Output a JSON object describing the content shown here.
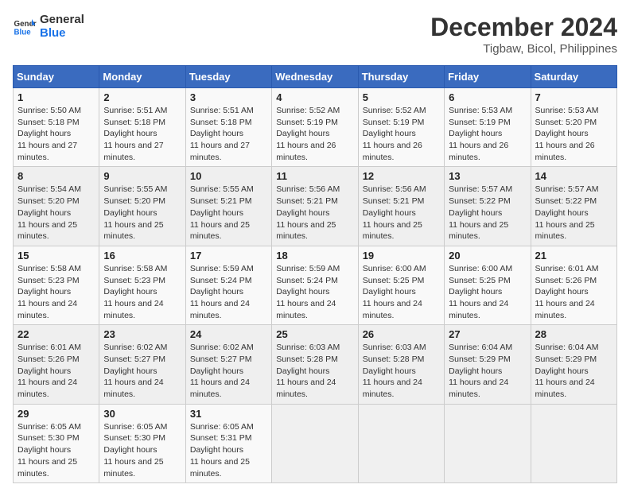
{
  "header": {
    "logo_line1": "General",
    "logo_line2": "Blue",
    "main_title": "December 2024",
    "subtitle": "Tigbaw, Bicol, Philippines"
  },
  "calendar": {
    "weekdays": [
      "Sunday",
      "Monday",
      "Tuesday",
      "Wednesday",
      "Thursday",
      "Friday",
      "Saturday"
    ],
    "weeks": [
      [
        {
          "day": "1",
          "sunrise": "5:50 AM",
          "sunset": "5:18 PM",
          "daylight": "11 hours and 27 minutes."
        },
        {
          "day": "2",
          "sunrise": "5:51 AM",
          "sunset": "5:18 PM",
          "daylight": "11 hours and 27 minutes."
        },
        {
          "day": "3",
          "sunrise": "5:51 AM",
          "sunset": "5:18 PM",
          "daylight": "11 hours and 27 minutes."
        },
        {
          "day": "4",
          "sunrise": "5:52 AM",
          "sunset": "5:19 PM",
          "daylight": "11 hours and 26 minutes."
        },
        {
          "day": "5",
          "sunrise": "5:52 AM",
          "sunset": "5:19 PM",
          "daylight": "11 hours and 26 minutes."
        },
        {
          "day": "6",
          "sunrise": "5:53 AM",
          "sunset": "5:19 PM",
          "daylight": "11 hours and 26 minutes."
        },
        {
          "day": "7",
          "sunrise": "5:53 AM",
          "sunset": "5:20 PM",
          "daylight": "11 hours and 26 minutes."
        }
      ],
      [
        {
          "day": "8",
          "sunrise": "5:54 AM",
          "sunset": "5:20 PM",
          "daylight": "11 hours and 25 minutes."
        },
        {
          "day": "9",
          "sunrise": "5:55 AM",
          "sunset": "5:20 PM",
          "daylight": "11 hours and 25 minutes."
        },
        {
          "day": "10",
          "sunrise": "5:55 AM",
          "sunset": "5:21 PM",
          "daylight": "11 hours and 25 minutes."
        },
        {
          "day": "11",
          "sunrise": "5:56 AM",
          "sunset": "5:21 PM",
          "daylight": "11 hours and 25 minutes."
        },
        {
          "day": "12",
          "sunrise": "5:56 AM",
          "sunset": "5:21 PM",
          "daylight": "11 hours and 25 minutes."
        },
        {
          "day": "13",
          "sunrise": "5:57 AM",
          "sunset": "5:22 PM",
          "daylight": "11 hours and 25 minutes."
        },
        {
          "day": "14",
          "sunrise": "5:57 AM",
          "sunset": "5:22 PM",
          "daylight": "11 hours and 25 minutes."
        }
      ],
      [
        {
          "day": "15",
          "sunrise": "5:58 AM",
          "sunset": "5:23 PM",
          "daylight": "11 hours and 24 minutes."
        },
        {
          "day": "16",
          "sunrise": "5:58 AM",
          "sunset": "5:23 PM",
          "daylight": "11 hours and 24 minutes."
        },
        {
          "day": "17",
          "sunrise": "5:59 AM",
          "sunset": "5:24 PM",
          "daylight": "11 hours and 24 minutes."
        },
        {
          "day": "18",
          "sunrise": "5:59 AM",
          "sunset": "5:24 PM",
          "daylight": "11 hours and 24 minutes."
        },
        {
          "day": "19",
          "sunrise": "6:00 AM",
          "sunset": "5:25 PM",
          "daylight": "11 hours and 24 minutes."
        },
        {
          "day": "20",
          "sunrise": "6:00 AM",
          "sunset": "5:25 PM",
          "daylight": "11 hours and 24 minutes."
        },
        {
          "day": "21",
          "sunrise": "6:01 AM",
          "sunset": "5:26 PM",
          "daylight": "11 hours and 24 minutes."
        }
      ],
      [
        {
          "day": "22",
          "sunrise": "6:01 AM",
          "sunset": "5:26 PM",
          "daylight": "11 hours and 24 minutes."
        },
        {
          "day": "23",
          "sunrise": "6:02 AM",
          "sunset": "5:27 PM",
          "daylight": "11 hours and 24 minutes."
        },
        {
          "day": "24",
          "sunrise": "6:02 AM",
          "sunset": "5:27 PM",
          "daylight": "11 hours and 24 minutes."
        },
        {
          "day": "25",
          "sunrise": "6:03 AM",
          "sunset": "5:28 PM",
          "daylight": "11 hours and 24 minutes."
        },
        {
          "day": "26",
          "sunrise": "6:03 AM",
          "sunset": "5:28 PM",
          "daylight": "11 hours and 24 minutes."
        },
        {
          "day": "27",
          "sunrise": "6:04 AM",
          "sunset": "5:29 PM",
          "daylight": "11 hours and 24 minutes."
        },
        {
          "day": "28",
          "sunrise": "6:04 AM",
          "sunset": "5:29 PM",
          "daylight": "11 hours and 24 minutes."
        }
      ],
      [
        {
          "day": "29",
          "sunrise": "6:05 AM",
          "sunset": "5:30 PM",
          "daylight": "11 hours and 25 minutes."
        },
        {
          "day": "30",
          "sunrise": "6:05 AM",
          "sunset": "5:30 PM",
          "daylight": "11 hours and 25 minutes."
        },
        {
          "day": "31",
          "sunrise": "6:05 AM",
          "sunset": "5:31 PM",
          "daylight": "11 hours and 25 minutes."
        },
        null,
        null,
        null,
        null
      ]
    ]
  }
}
